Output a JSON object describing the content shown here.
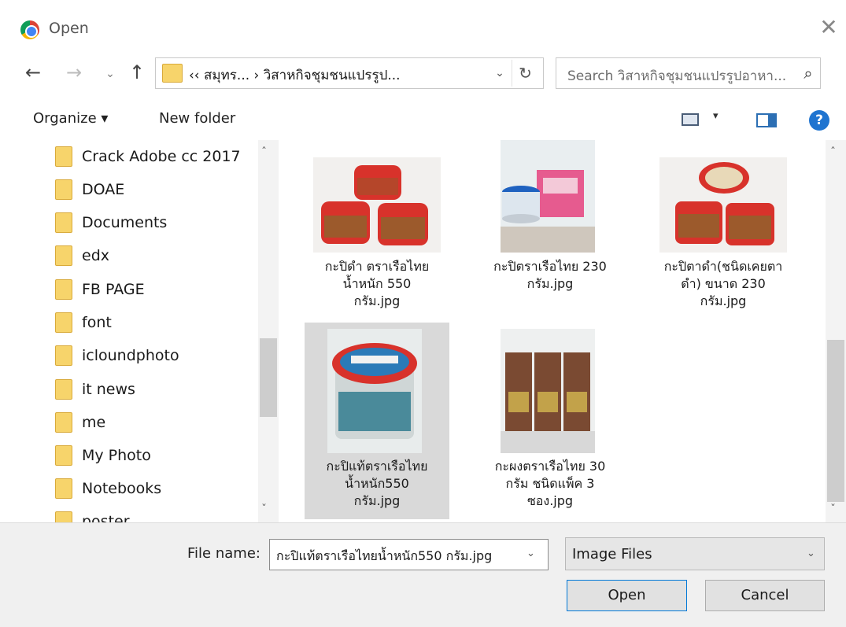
{
  "window": {
    "title": "Open",
    "icon": "chrome-icon",
    "close_glyph": "✕"
  },
  "nav": {
    "back": "←",
    "forward": "→",
    "recent": "⌄",
    "up": "↑"
  },
  "address": {
    "path": "‹‹  สมุทร...  ›  วิสาหกิจชุมชนแปรรูป...",
    "dropdown": "⌄",
    "refresh": "↻"
  },
  "search": {
    "placeholder": "Search วิสาหกิจชุมชนแปรรูปอาหา...",
    "icon": "⌕"
  },
  "toolbar": {
    "organize": "Organize ▾",
    "new_folder": "New folder",
    "view_dd": "▾",
    "help": "?"
  },
  "folders": [
    "Crack Adobe cc 2017",
    "DOAE",
    "Documents",
    "edx",
    "FB PAGE",
    "font",
    "icloundphoto",
    "it news",
    "me",
    "My Photo",
    "Notebooks",
    "poster"
  ],
  "files": [
    {
      "name": [
        "กะปิดำ ตราเรือไทย",
        "น้ำหนัก 550",
        "กรัม.jpg"
      ],
      "selected": false
    },
    {
      "name": [
        "กะปิตราเรือไทย 230",
        "กรัม.jpg"
      ],
      "selected": false
    },
    {
      "name": [
        "กะปิตาดำ(ชนิดเคยตา",
        "ดำ) ขนาด 230",
        "กรัม.jpg"
      ],
      "selected": false
    },
    {
      "name": [
        "กะปิแท้ตราเรือไทย",
        "น้ำหนัก550",
        "กรัม.jpg"
      ],
      "selected": true
    },
    {
      "name": [
        "กะผงตราเรือไทย 30",
        "กรัม ชนิดแพ็ค 3",
        "ซอง.jpg"
      ],
      "selected": false
    }
  ],
  "bottom": {
    "file_name_label": "File name:",
    "file_name_value": "กะปิแท้ตราเรือไทยน้ำหนัก550 กรัม.jpg",
    "filter_value": "Image Files",
    "open_label": "Open",
    "cancel_label": "Cancel"
  },
  "scroll": {
    "up": "ˆ",
    "down": "ˇ"
  }
}
